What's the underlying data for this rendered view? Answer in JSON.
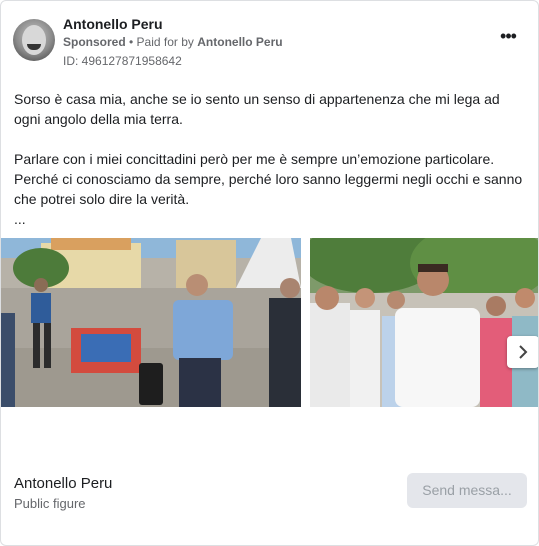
{
  "header": {
    "page_name": "Antonello Peru",
    "sponsored": "Sponsored",
    "paid_for_prefix": " • Paid for by ",
    "paid_for_name": "Antonello Peru",
    "ad_id": "ID: 496127871958642",
    "more_label": "•••"
  },
  "post": {
    "paragraph1": "Sorso è casa mia, anche se io sento un senso di appartenenza che mi lega ad ogni angolo della mia terra.",
    "paragraph2": "Parlare con i miei concittadini però per me è sempre un’emozione particolare. Perché ci conosciamo da sempre, perché loro sanno leggermi negli occhi e sanno che potrei solo dire la verità.",
    "ellipsis": "..."
  },
  "carousel": {
    "slides": [
      "outdoor-rally-speaker",
      "crowd-speaker"
    ],
    "next_icon": "chevron-right-icon"
  },
  "footer": {
    "name": "Antonello Peru",
    "category": "Public figure",
    "send_button": "Send messa..."
  }
}
